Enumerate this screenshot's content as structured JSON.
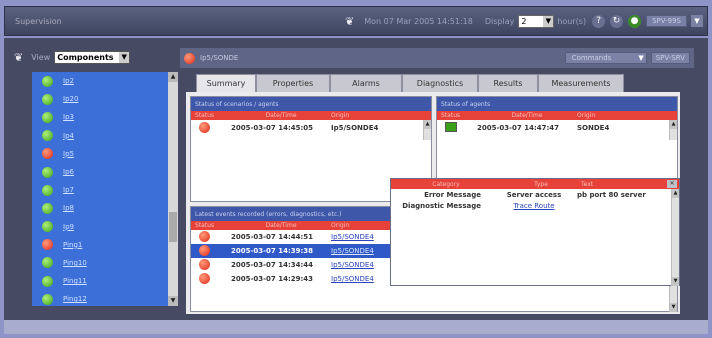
{
  "topbar": {
    "title": "Supervision",
    "datetime": "Mon 07 Mar 2005 14:51:18",
    "display_label": "Display",
    "display_value": "2",
    "hours_label": "hour(s)",
    "server": "SPV-99S"
  },
  "left_panel": {
    "view_label": "View",
    "view_value": "Components",
    "items": [
      {
        "label": "Ip2",
        "status": "green"
      },
      {
        "label": "Ip20",
        "status": "green"
      },
      {
        "label": "Ip3",
        "status": "green"
      },
      {
        "label": "Ip4",
        "status": "green"
      },
      {
        "label": "Ip5",
        "status": "red"
      },
      {
        "label": "Ip6",
        "status": "green"
      },
      {
        "label": "Ip7",
        "status": "green"
      },
      {
        "label": "Ip8",
        "status": "green"
      },
      {
        "label": "Ip9",
        "status": "green"
      },
      {
        "label": "Ping1",
        "status": "red"
      },
      {
        "label": "Ping10",
        "status": "green"
      },
      {
        "label": "Ping11",
        "status": "green"
      },
      {
        "label": "Ping12",
        "status": "green"
      }
    ]
  },
  "right_panel": {
    "path": "Ip5/SONDE",
    "commands_label": "Commands",
    "server": "SPV-SRV",
    "tabs": [
      "Summary",
      "Properties",
      "Alarms",
      "Diagnostics",
      "Results",
      "Measurements"
    ],
    "scenarios": {
      "title": "Status of scenarios / agents",
      "columns": [
        "Status",
        "Date/Time",
        "Origin"
      ],
      "rows": [
        {
          "status": "red",
          "datetime": "2005-03-07 14:45:05",
          "origin": "Ip5/SONDE4"
        }
      ]
    },
    "agents": {
      "title": "Status of agents",
      "columns": [
        "Status",
        "Date/Time",
        "Origin"
      ],
      "rows": [
        {
          "datetime": "2005-03-07 14:47:47",
          "origin": "SONDE4"
        }
      ]
    },
    "events": {
      "title": "Latest events recorded (errors, diagnostics, etc.)",
      "columns": [
        "Status",
        "Date/Time",
        "Origin"
      ],
      "rows": [
        {
          "status": "red",
          "datetime": "2005-03-07 14:44:51",
          "origin": "Ip5/SONDE4",
          "selected": false
        },
        {
          "status": "red",
          "datetime": "2005-03-07 14:39:38",
          "origin": "Ip5/SONDE4",
          "selected": true
        },
        {
          "status": "red",
          "datetime": "2005-03-07 14:34:44",
          "origin": "Ip5/SONDE4",
          "selected": false
        },
        {
          "status": "red",
          "datetime": "2005-03-07 14:29:43",
          "origin": "Ip5/SONDE4",
          "selected": false
        }
      ]
    },
    "popup": {
      "columns": [
        "Category",
        "Type",
        "Text"
      ],
      "rows": [
        {
          "category": "Error Message",
          "type": "Server access",
          "text": "pb port 80 server"
        },
        {
          "category": "Diagnostic Message",
          "type": "Trace Route",
          "text": ""
        }
      ]
    }
  }
}
